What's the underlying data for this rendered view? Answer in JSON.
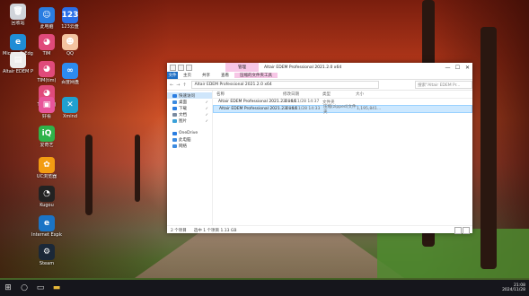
{
  "desktop": {
    "icons": [
      {
        "name": "recycle-bin-icon",
        "label": "回收站",
        "color": "#d0d4da",
        "glyph": "🗑"
      },
      {
        "name": "app-blue-icon",
        "label": "此电脑",
        "color": "#2a7de1",
        "glyph": "☺"
      },
      {
        "name": "app-123-icon",
        "label": "123云盘",
        "color": "#2a6fe8",
        "glyph": "123"
      },
      {
        "name": "edge-icon",
        "label": "Microsoft Edge",
        "color": "#1f8dd6",
        "glyph": "e"
      },
      {
        "name": "app-pink-icon",
        "label": "TIM",
        "color": "#e04a7a",
        "glyph": "◕"
      },
      {
        "name": "app-avatar-icon",
        "label": "QQ",
        "color": "#f4c4a0",
        "glyph": "☻"
      },
      {
        "name": "file-icon",
        "label": "Altair EDEM Professional...",
        "color": "#ececec",
        "glyph": "▤"
      },
      {
        "name": "app-pink2-icon",
        "label": "TIM(tim)",
        "color": "#e04a7a",
        "glyph": "◕"
      },
      {
        "name": "app-blue2-icon",
        "label": "百度网盘",
        "color": "#2d8bf0",
        "glyph": "∞"
      },
      {
        "name": "app-pink3-icon",
        "label": "TIM(tim)",
        "color": "#e04a7a",
        "glyph": "◕"
      },
      {
        "name": "app-pink4-icon",
        "label": "好看",
        "color": "#e8559a",
        "glyph": "▣"
      },
      {
        "name": "app-teal-icon",
        "label": "Xmind",
        "color": "#1fa0d0",
        "glyph": "✕"
      },
      {
        "name": "iqiyi-icon",
        "label": "爱奇艺",
        "color": "#2fb34a",
        "glyph": "iQ"
      },
      {
        "name": "app-orange-icon",
        "label": "UC浏览器",
        "color": "#f39c12",
        "glyph": "✿"
      },
      {
        "name": "app-black-icon",
        "label": "Kugou",
        "color": "#222",
        "glyph": "◔"
      },
      {
        "name": "ie-icon",
        "label": "Internet Explorer",
        "color": "#1b74c6",
        "glyph": "e"
      },
      {
        "name": "steam-icon",
        "label": "Steam",
        "color": "#1b2838",
        "glyph": "⚙"
      }
    ]
  },
  "window": {
    "manage_tab": "管理",
    "title": "Altair EDEM Professional 2021.2.0 x64",
    "controls": {
      "minimize": "—",
      "maximize": "☐",
      "close": "✕"
    },
    "ribbon": {
      "file": "文件",
      "home": "主页",
      "share": "共享",
      "view": "查看",
      "tools": "压缩的文件夹工具"
    },
    "address": "Altair EDEM Professional 2021.2.0 x64",
    "search_placeholder": "搜索\"Altair EDEM Pr...",
    "nav_back": "←",
    "nav_forward": "→",
    "nav_up": "↑",
    "sidebar": [
      {
        "label": "快速访问",
        "color": "#2a7de1",
        "pin": ""
      },
      {
        "label": "桌面",
        "color": "#3d8be0",
        "pin": "✓"
      },
      {
        "label": "下载",
        "color": "#2a7de1",
        "pin": "✓"
      },
      {
        "label": "文档",
        "color": "#7a8aa0",
        "pin": "✓"
      },
      {
        "label": "图片",
        "color": "#3aa0d8",
        "pin": "✓"
      },
      {
        "label": "",
        "color": "",
        "pin": ""
      },
      {
        "label": "OneDrive",
        "color": "#2a7de1",
        "pin": ""
      },
      {
        "label": "此电脑",
        "color": "#3d8be0",
        "pin": ""
      },
      {
        "label": "网络",
        "color": "#3d8be0",
        "pin": ""
      }
    ],
    "columns": {
      "name": "名称",
      "date": "修改日期",
      "type": "类型",
      "size": "大小"
    },
    "files": [
      {
        "name": "Altair EDEM Professional 2021.2.0 x64",
        "date": "2024/11/28 14:37",
        "type": "文件夹",
        "size": "",
        "selected": false
      },
      {
        "name": "Altair EDEM Professional 2021.2.0 x64",
        "date": "2024/11/28 14:33",
        "type": "压缩(zipped)文件夹",
        "size": "1,195,841...",
        "selected": true
      }
    ],
    "status": {
      "count": "2 个项目",
      "selected": "选中 1 个项目  1.13 GB"
    }
  },
  "taskbar": {
    "start": "⊞",
    "search": "○",
    "taskview": "▭",
    "explorer": "▬",
    "time": "21:08",
    "date": "2024/11/28"
  }
}
